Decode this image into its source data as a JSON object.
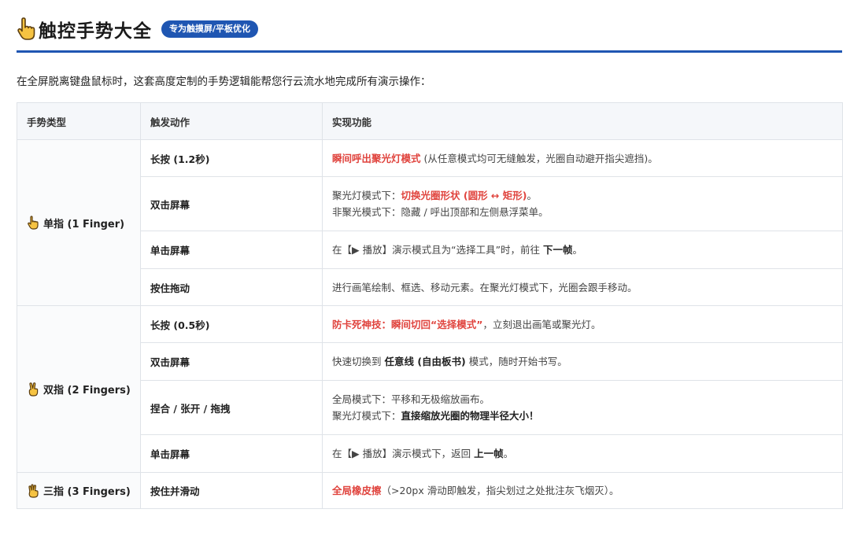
{
  "header": {
    "title": "触控手势大全",
    "badge": "专为触摸屏/平板优化"
  },
  "intro": "在全屏脱离键盘鼠标时，这套高度定制的手势逻辑能帮您行云流水地完成所有演示操作：",
  "table": {
    "columns": [
      "手势类型",
      "触发动作",
      "实现功能"
    ],
    "groups": [
      {
        "type": "单指 (1 Finger)",
        "icon": "one-finger-pointing-icon",
        "rows": [
          {
            "action": "长按 (1.2秒)",
            "lines": [
              [
                {
                  "t": "瞬间呼出聚光灯模式",
                  "s": "hl"
                },
                {
                  "t": " (从任意模式均可无缝触发，光圈自动避开指尖遮挡)。"
                }
              ]
            ]
          },
          {
            "action": "双击屏幕",
            "lines": [
              [
                {
                  "t": "聚光灯模式下："
                },
                {
                  "t": "切换光圈形状 (圆形 ↔ 矩形)",
                  "s": "hl"
                },
                {
                  "t": "。"
                }
              ],
              [
                {
                  "t": "非聚光模式下：隐藏 / 呼出顶部和左侧悬浮菜单。"
                }
              ]
            ]
          },
          {
            "action": "单击屏幕",
            "lines": [
              [
                {
                  "t": "在【▶ 播放】演示模式且为“选择工具”时，前往 "
                },
                {
                  "t": "下一帧",
                  "s": "bd"
                },
                {
                  "t": "。"
                }
              ]
            ]
          },
          {
            "action": "按住拖动",
            "lines": [
              [
                {
                  "t": "进行画笔绘制、框选、移动元素。在聚光灯模式下，光圈会跟手移动。"
                }
              ]
            ]
          }
        ]
      },
      {
        "type": "双指 (2 Fingers)",
        "icon": "two-fingers-victory-icon",
        "rows": [
          {
            "action": "长按 (0.5秒)",
            "lines": [
              [
                {
                  "t": "防卡死神技：瞬间切回“选择模式”",
                  "s": "hl"
                },
                {
                  "t": "，立刻退出画笔或聚光灯。"
                }
              ]
            ]
          },
          {
            "action": "双击屏幕",
            "lines": [
              [
                {
                  "t": "快速切换到 "
                },
                {
                  "t": "任意线 (自由板书)",
                  "s": "bd"
                },
                {
                  "t": " 模式，随时开始书写。"
                }
              ]
            ]
          },
          {
            "action": "捏合 / 张开 / 拖拽",
            "lines": [
              [
                {
                  "t": "全局模式下：平移和无极缩放画布。"
                }
              ],
              [
                {
                  "t": "聚光灯模式下："
                },
                {
                  "t": "直接缩放光圈的物理半径大小！",
                  "s": "bd"
                }
              ]
            ]
          },
          {
            "action": "单击屏幕",
            "lines": [
              [
                {
                  "t": "在【▶ 播放】演示模式下，返回 "
                },
                {
                  "t": "上一帧",
                  "s": "bd"
                },
                {
                  "t": "。"
                }
              ]
            ]
          }
        ]
      },
      {
        "type": "三指 (3 Fingers)",
        "icon": "three-fingers-hand-icon",
        "rows": [
          {
            "action": "按住并滑动",
            "lines": [
              [
                {
                  "t": "全局橡皮擦",
                  "s": "hl"
                },
                {
                  "t": "（>20px 滑动即触发，指尖划过之处批注灰飞烟灭）。"
                }
              ]
            ]
          }
        ]
      }
    ]
  },
  "colors": {
    "accent": "#1f56b2",
    "highlight": "#e0443e",
    "hand_fill": "#f6c342",
    "hand_stroke": "#5a3d10"
  }
}
